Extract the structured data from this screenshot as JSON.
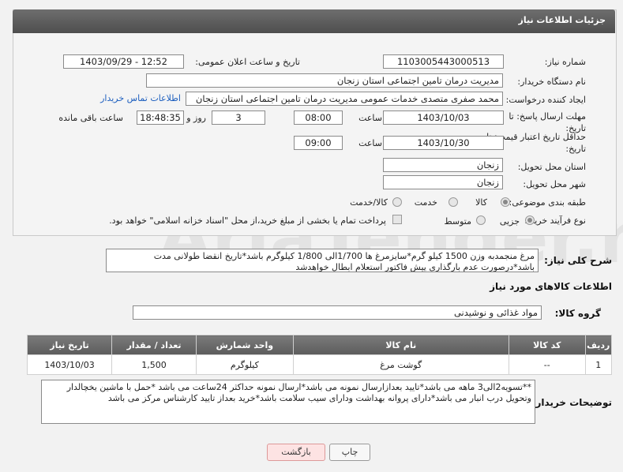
{
  "header": {
    "title": "جزئیات اطلاعات نیاز"
  },
  "fields": {
    "need_number_label": "شماره نیاز:",
    "need_number": "1103005443000513",
    "announce_label": "تاریخ و ساعت اعلان عمومی:",
    "announce_value": "1403/09/29 - 12:52",
    "buyer_org_label": "نام دستگاه خریدار:",
    "buyer_org": "مدیریت درمان تامین اجتماعی استان زنجان",
    "requester_label": "ایجاد کننده درخواست:",
    "requester": "محمد صفری متصدی خدمات عمومی مدیریت درمان تامین اجتماعی استان زنجان",
    "contact_link": "اطلاعات تماس خریدار",
    "reply_deadline_label": "مهلت ارسال پاسخ: تا تاریخ:",
    "reply_date": "1403/10/03",
    "time_label": "ساعت",
    "reply_time": "08:00",
    "days_count": "3",
    "days_label": "روز و",
    "remaining_time": "18:48:35",
    "remaining_label": "ساعت باقی مانده",
    "price_valid_label": "حداقل تاریخ اعتبار قیمت: تا تاریخ:",
    "price_date": "1403/10/30",
    "price_time": "09:00",
    "province_label": "استان محل تحویل:",
    "province": "زنجان",
    "city_label": "شهر محل تحویل:",
    "city": "زنجان",
    "category_label": "طبقه بندی موضوعی:",
    "cat_goods": "کالا",
    "cat_service": "خدمت",
    "cat_goods_service": "کالا/خدمت",
    "process_label": "نوع فرآیند خرید :",
    "proc_partial": "جزیی",
    "proc_medium": "متوسط",
    "payment_note": "پرداخت تمام یا بخشی از مبلغ خرید،از محل \"اسناد خزانه اسلامی\" خواهد بود."
  },
  "description": {
    "label": "شرح کلی نیاز:",
    "text": "مرغ منجمدبه وزن 1500 کیلو گرم*سایزمرغ ها 1/700الی 1/800 کیلوگرم باشد*تاریخ انقضا طولانی مدت باشد*درصورت عدم بارگذاری پیش فاکتور استعلام ابطال خواهدشد"
  },
  "goods_section": {
    "title": "اطلاعات کالاهای مورد نیاز",
    "group_label": "گروه کالا:",
    "group_value": "مواد غذائی و نوشیدنی"
  },
  "table": {
    "headers": [
      "ردیف",
      "کد کالا",
      "نام کالا",
      "واحد شمارش",
      "تعداد / مقدار",
      "تاریخ نیاز"
    ],
    "rows": [
      [
        "1",
        "--",
        "گوشت مرغ",
        "کیلوگرم",
        "1,500",
        "1403/10/03"
      ]
    ]
  },
  "buyer_notes": {
    "label": "توضیحات خریدار:",
    "text": "**تسویه2الی3 ماهه می باشد*تایید بعدازارسال نمونه می باشد*ارسال نمونه حداکثر 24ساعت می باشد *حمل با ماشین یخچالدار وتحویل درب انبار می باشد*دارای پروانه بهداشت ودارای سیب سلامت باشد*خرید بعداز تایید کارشناس مرکز می باشد"
  },
  "buttons": {
    "print": "چاپ",
    "back": "بازگشت"
  },
  "watermark": "AriaTender.neT"
}
